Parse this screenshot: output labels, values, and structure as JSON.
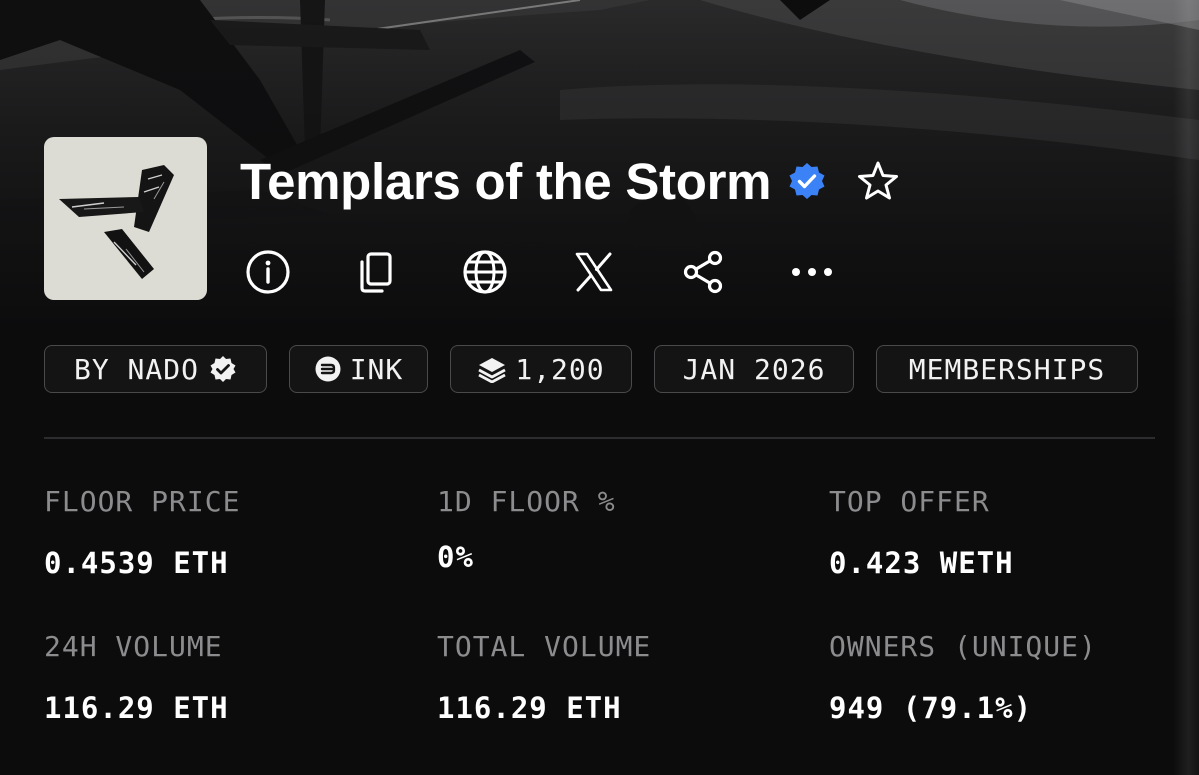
{
  "collection": {
    "name": "Templars of the Storm",
    "verified_icon": "verified-badge-icon",
    "favorite_icon": "star-outline-icon"
  },
  "actions": [
    {
      "id": "info",
      "icon": "info-icon"
    },
    {
      "id": "copy",
      "icon": "copy-icon"
    },
    {
      "id": "website",
      "icon": "globe-icon"
    },
    {
      "id": "x",
      "icon": "x-logo-icon"
    },
    {
      "id": "share",
      "icon": "share-icon"
    },
    {
      "id": "more",
      "icon": "more-horizontal-icon"
    }
  ],
  "tags": {
    "creator": "BY NADO",
    "chain": "INK",
    "supply": "1,200",
    "date": "JAN 2026",
    "category": "MEMBERSHIPS"
  },
  "stats": {
    "floor_price": {
      "label": "FLOOR PRICE",
      "value": "0.4539 ETH"
    },
    "floor_change_1d": {
      "label": "1D FLOOR %",
      "value": "0%"
    },
    "top_offer": {
      "label": "TOP OFFER",
      "value": "0.423 WETH"
    },
    "volume_24h": {
      "label": "24H VOLUME",
      "value": "116.29 ETH"
    },
    "total_volume": {
      "label": "TOTAL VOLUME",
      "value": "116.29 ETH"
    },
    "owners": {
      "label": "OWNERS (UNIQUE)",
      "value": "949 (79.1%)"
    }
  },
  "colors": {
    "background": "#0c0c0d",
    "verified_blue": "#3b82f6",
    "tag_border": "#4a4a4c",
    "label_gray": "#8c8c8e"
  }
}
